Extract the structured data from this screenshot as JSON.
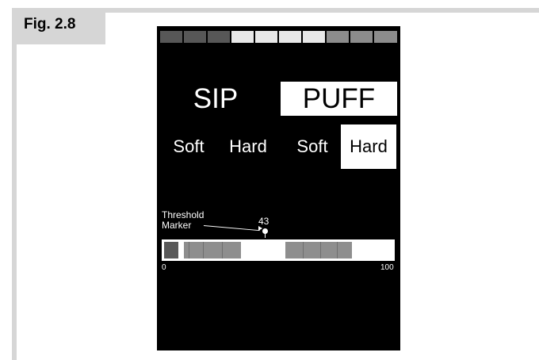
{
  "figure": {
    "label": "Fig. 2.8"
  },
  "indicator_row": {
    "cells": [
      "#575757",
      "#575757",
      "#575757",
      "#e8e8e8",
      "#e8e8e8",
      "#e8e8e8",
      "#e8e8e8",
      "#8c8c8c",
      "#8c8c8c",
      "#8c8c8c"
    ]
  },
  "mode": {
    "sip_label": "SIP",
    "puff_label": "PUFF",
    "selected": "PUFF"
  },
  "strength": {
    "options": [
      "Soft",
      "Hard",
      "Soft",
      "Hard"
    ],
    "selected_index": 3
  },
  "threshold": {
    "caption_line1": "Threshold",
    "caption_line2": "Marker",
    "value_text": "43",
    "value": 43
  },
  "level_bar": {
    "min_label": "0",
    "max_label": "100",
    "colors": {
      "filled": "#8e8e8e",
      "empty": "#ffffff",
      "start_block": "#595959"
    }
  }
}
